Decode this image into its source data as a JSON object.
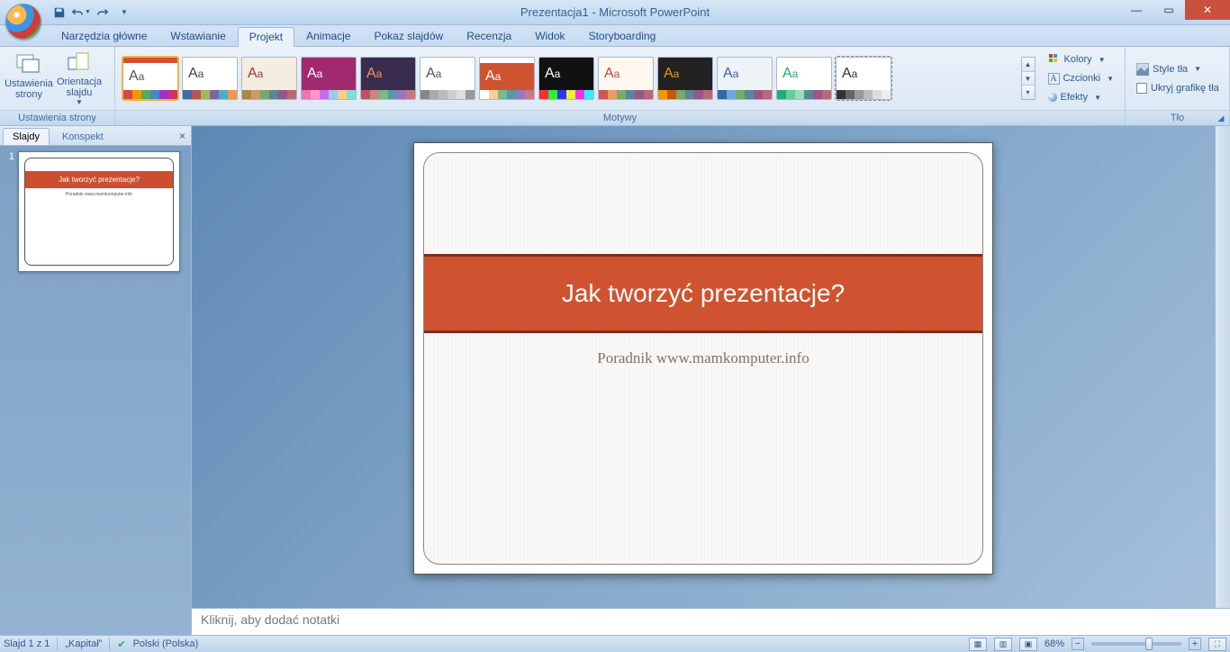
{
  "title": "Prezentacja1 - Microsoft PowerPoint",
  "qat": {
    "save": "save-icon",
    "undo": "undo-icon",
    "redo": "redo-icon"
  },
  "tabs": [
    "Narzędzia główne",
    "Wstawianie",
    "Projekt",
    "Animacje",
    "Pokaz slajdów",
    "Recenzja",
    "Widok",
    "Storyboarding"
  ],
  "active_tab": 2,
  "ribbon": {
    "group_setup": {
      "btn_page": "Ustawienia strony",
      "btn_orient": "Orientacja slajdu",
      "label": "Ustawienia strony"
    },
    "group_themes": {
      "label": "Motywy"
    },
    "group_themes_opts": {
      "colors": "Kolory",
      "fonts": "Czcionki",
      "effects": "Efekty"
    },
    "group_bg": {
      "styles": "Style tła",
      "hide": "Ukryj grafikę tła",
      "label": "Tło"
    }
  },
  "left_panel": {
    "tab_slides": "Slajdy",
    "tab_outline": "Konspekt"
  },
  "slide": {
    "title": "Jak tworzyć prezentacje?",
    "subtitle": "Poradnik www.mamkomputer.info"
  },
  "notes_placeholder": "Kliknij, aby dodać notatki",
  "status": {
    "slide": "Slajd 1 z 1",
    "theme": "„Kapitał”",
    "lang": "Polski (Polska)",
    "zoom": "68%"
  },
  "themes": [
    {
      "bg": "#ffffff",
      "fg": "#cf5330",
      "aa": "#555",
      "strip": [
        "#d44",
        "#e90",
        "#5a5",
        "#48c",
        "#93c",
        "#c36"
      ],
      "sel": true,
      "band": true
    },
    {
      "bg": "#ffffff",
      "fg": "#444",
      "aa": "#444",
      "strip": [
        "#3b6ea5",
        "#c0504d",
        "#9bbb59",
        "#8064a2",
        "#4bacc6",
        "#f79646"
      ]
    },
    {
      "bg": "#f5eddf",
      "fg": "#9a3a2f",
      "aa": "#9a3a2f",
      "strip": [
        "#a84",
        "#c96",
        "#7a6",
        "#589",
        "#958",
        "#b67"
      ]
    },
    {
      "bg": "#a12a6e",
      "fg": "#fff",
      "aa": "#fff",
      "strip": [
        "#e7a",
        "#f9c",
        "#c6e",
        "#9ce",
        "#fc8",
        "#8dc"
      ]
    },
    {
      "bg": "#3a2c4e",
      "fg": "#e96",
      "aa": "#e96",
      "strip": [
        "#b56",
        "#c87",
        "#7b8",
        "#59a",
        "#97b",
        "#c78"
      ]
    },
    {
      "bg": "#ffffff",
      "fg": "#555",
      "aa": "#555",
      "strip": [
        "#888",
        "#aaa",
        "#bbb",
        "#ccc",
        "#ddd",
        "#999"
      ]
    },
    {
      "bg": "#cf5330",
      "fg": "#fff",
      "aa": "#fff",
      "strip": [
        "#fff",
        "#fc9",
        "#7b8",
        "#59a",
        "#97b",
        "#c78"
      ],
      "band": true
    },
    {
      "bg": "#111",
      "fg": "#fff",
      "aa": "#fff",
      "strip": [
        "#e33",
        "#3e3",
        "#33e",
        "#ee3",
        "#e3e",
        "#3ee"
      ]
    },
    {
      "bg": "#fef8ee",
      "fg": "#b44",
      "aa": "#b44",
      "strip": [
        "#c55",
        "#e96",
        "#7a6",
        "#589",
        "#958",
        "#b67"
      ]
    },
    {
      "bg": "#222",
      "fg": "#e90",
      "aa": "#e90",
      "strip": [
        "#e90",
        "#c50",
        "#7a6",
        "#589",
        "#958",
        "#b67"
      ]
    },
    {
      "bg": "#eef3f8",
      "fg": "#36a",
      "aa": "#36a",
      "strip": [
        "#36a",
        "#6ad",
        "#7a6",
        "#589",
        "#958",
        "#b67"
      ]
    },
    {
      "bg": "#ffffff",
      "fg": "#2a7",
      "aa": "#2a7",
      "strip": [
        "#2a7",
        "#6c9",
        "#9db",
        "#589",
        "#958",
        "#b67"
      ]
    },
    {
      "bg": "#ffffff",
      "fg": "#333",
      "aa": "#333",
      "strip": [
        "#333",
        "#666",
        "#999",
        "#bbb",
        "#ddd",
        "#eee"
      ],
      "outline": true
    }
  ]
}
